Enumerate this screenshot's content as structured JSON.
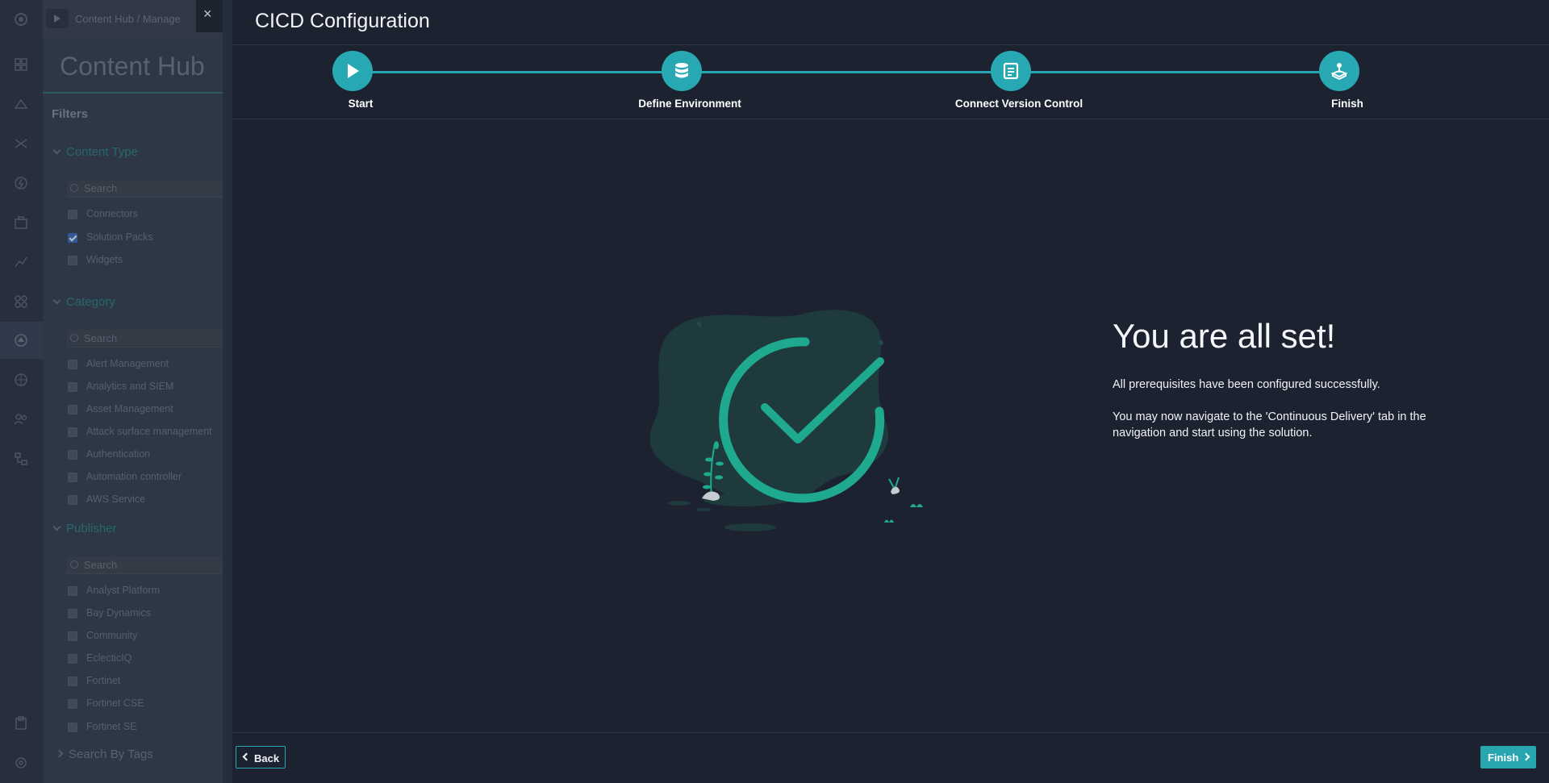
{
  "background": {
    "breadcrumb": "Content Hub /  Manage",
    "hub_title": "Content Hub",
    "filters_label": "Filters",
    "content_type": {
      "heading": "Content Type",
      "search_placeholder": "Search",
      "items": [
        {
          "label": "Connectors",
          "checked": false
        },
        {
          "label": "Solution Packs",
          "checked": true
        },
        {
          "label": "Widgets",
          "checked": false
        }
      ]
    },
    "category": {
      "heading": "Category",
      "search_placeholder": "Search",
      "items": [
        {
          "label": "Alert Management"
        },
        {
          "label": "Analytics and SIEM"
        },
        {
          "label": "Asset Management"
        },
        {
          "label": "Attack surface management"
        },
        {
          "label": "Authentication"
        },
        {
          "label": "Automation controller"
        },
        {
          "label": "AWS Service"
        }
      ]
    },
    "publisher": {
      "heading": "Publisher",
      "search_placeholder": "Search",
      "items": [
        {
          "label": "Analyst Platform"
        },
        {
          "label": "Bay Dynamics"
        },
        {
          "label": "Community"
        },
        {
          "label": "EclecticIQ"
        },
        {
          "label": "Fortinet"
        },
        {
          "label": "Fortinet CSE"
        },
        {
          "label": "Fortinet SE"
        }
      ]
    },
    "tags_heading": "Search By Tags"
  },
  "modal": {
    "close_glyph": "×",
    "title": "CICD Configuration",
    "steps": [
      {
        "label": "Start",
        "icon": "play-icon"
      },
      {
        "label": "Define Environment",
        "icon": "database-icon"
      },
      {
        "label": "Connect Version Control",
        "icon": "list-document-icon"
      },
      {
        "label": "Finish",
        "icon": "joystick-icon"
      }
    ],
    "heading": "You are all set!",
    "message_1": "All prerequisites have been configured successfully.",
    "message_2": "You may now navigate to the 'Continuous Delivery' tab in the navigation and start using the solution.",
    "back_label": "Back",
    "finish_label": "Finish"
  },
  "colors": {
    "accent": "#27a8b2",
    "check": "#1fa98f",
    "modal_bg": "#1c2230"
  }
}
